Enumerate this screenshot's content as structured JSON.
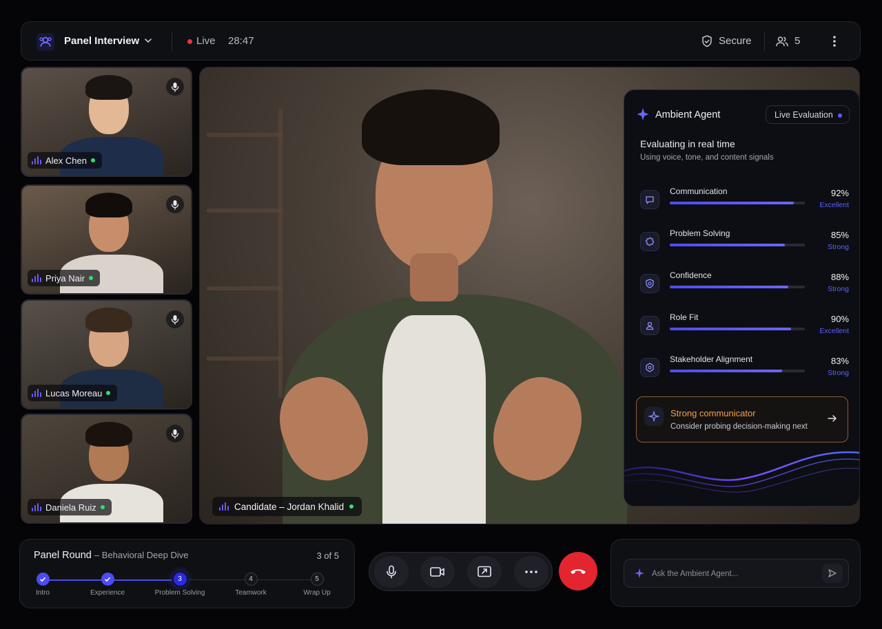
{
  "header": {
    "title": "Panel Interview",
    "status": "Live",
    "timer": "28:47",
    "secure_label": "Secure",
    "participant_count": "5"
  },
  "participants": [
    {
      "name": "Alex Chen",
      "skin": "#e3b894",
      "hair": "#1a1512",
      "shirt": "#1e2e4a",
      "bg": "#5b5048"
    },
    {
      "name": "Priya Nair",
      "skin": "#c68e6a",
      "hair": "#120d0b",
      "shirt": "#d9d3cb",
      "bg": "#6a5a4b"
    },
    {
      "name": "Lucas Moreau",
      "skin": "#d8a582",
      "hair": "#3a2a1e",
      "shirt": "#1e2c44",
      "bg": "#575049"
    },
    {
      "name": "Daniela Ruiz",
      "skin": "#b07a55",
      "hair": "#1a120d",
      "shirt": "#e6e2dc",
      "bg": "#4e463c"
    }
  ],
  "main_video": {
    "label": "Candidate – Jordan Khalid"
  },
  "agent": {
    "title": "Ambient Agent",
    "badge": "Live Evaluation",
    "heading": "Evaluating in real time",
    "subheading": "Using voice, tone, and content signals",
    "metrics": [
      {
        "label": "Communication",
        "value": "92%",
        "fraction": 0.92,
        "rating": "Excellent",
        "icon": "chat-icon"
      },
      {
        "label": "Problem Solving",
        "value": "85%",
        "fraction": 0.85,
        "rating": "Strong",
        "icon": "puzzle-icon"
      },
      {
        "label": "Confidence",
        "value": "88%",
        "fraction": 0.88,
        "rating": "Strong",
        "icon": "shield-check-icon"
      },
      {
        "label": "Role Fit",
        "value": "90%",
        "fraction": 0.9,
        "rating": "Excellent",
        "icon": "person-fit-icon"
      },
      {
        "label": "Stakeholder Alignment",
        "value": "83%",
        "fraction": 0.83,
        "rating": "Strong",
        "icon": "network-icon"
      }
    ],
    "insight_title": "Strong communicator",
    "insight_text": "Consider probing decision-making next"
  },
  "round": {
    "title": "Panel Round",
    "subtitle": "– Behavioral Deep Dive",
    "count": "3 of 5",
    "steps": [
      {
        "num": "1",
        "label": "Intro",
        "state": "done"
      },
      {
        "num": "2",
        "label": "Experience",
        "state": "done"
      },
      {
        "num": "3",
        "label": "Problem Solving",
        "state": "current"
      },
      {
        "num": "4",
        "label": "Teamwork",
        "state": "todo"
      },
      {
        "num": "5",
        "label": "Wrap Up",
        "state": "todo"
      }
    ]
  },
  "ask": {
    "placeholder": "Ask the Ambient Agent..."
  },
  "colors": {
    "accent": "#4e4cf2",
    "live": "#ef3340",
    "online": "#2ee36b",
    "end_call": "#e3252f",
    "insight": "#f0a14a"
  }
}
